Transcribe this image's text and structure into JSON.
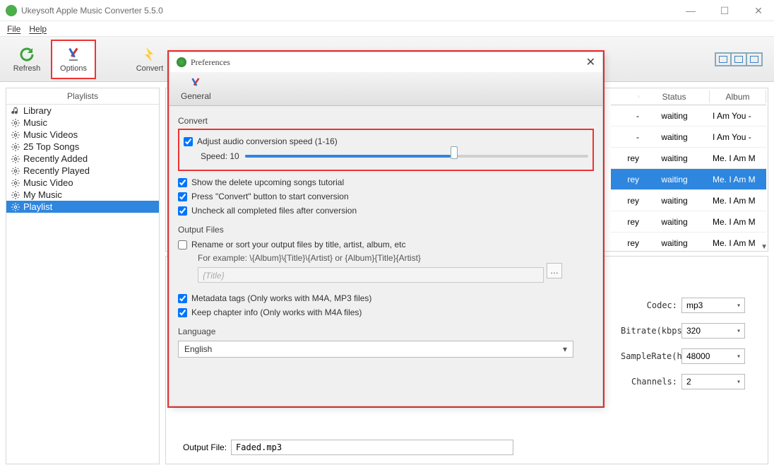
{
  "titlebar": {
    "title": "Ukeysoft Apple Music Converter 5.5.0"
  },
  "menu": {
    "file": "File",
    "help": "Help"
  },
  "toolbar": {
    "refresh": "Refresh",
    "options": "Options",
    "convert": "Convert"
  },
  "sidebar": {
    "header": "Playlists",
    "items": [
      {
        "label": "Library",
        "icon": "library"
      },
      {
        "label": "Music",
        "icon": "gear"
      },
      {
        "label": "Music Videos",
        "icon": "gear"
      },
      {
        "label": "25 Top Songs",
        "icon": "gear"
      },
      {
        "label": "Recently Added",
        "icon": "gear"
      },
      {
        "label": "Recently Played",
        "icon": "gear"
      },
      {
        "label": "Music Video",
        "icon": "gear"
      },
      {
        "label": "My Music",
        "icon": "gear"
      },
      {
        "label": "Playlist",
        "icon": "gear",
        "selected": true
      }
    ]
  },
  "table": {
    "headers": {
      "status": "Status",
      "album": "Album"
    },
    "rows": [
      {
        "c1": "-",
        "status": "waiting",
        "album": "I Am You -"
      },
      {
        "c1": "-",
        "status": "waiting",
        "album": "I Am You -"
      },
      {
        "c1": "rey",
        "status": "waiting",
        "album": "Me. I Am M"
      },
      {
        "c1": "rey",
        "status": "waiting",
        "album": "Me. I Am M",
        "sel": true
      },
      {
        "c1": "rey",
        "status": "waiting",
        "album": "Me. I Am M"
      },
      {
        "c1": "rey",
        "status": "waiting",
        "album": "Me. I Am M"
      },
      {
        "c1": "rey",
        "status": "waiting",
        "album": "Me. I Am M"
      }
    ]
  },
  "settings": {
    "codec_label": "Codec:",
    "codec": "mp3",
    "bitrate_label": "Bitrate(kbps):",
    "bitrate": "320",
    "samplerate_label": "SampleRate(hz):",
    "samplerate": "48000",
    "channels_label": "Channels:",
    "channels": "2"
  },
  "output": {
    "label": "Output File:",
    "value": "Faded.mp3"
  },
  "pref": {
    "title": "Preferences",
    "general_tab": "General",
    "convert_section": "Convert",
    "adjust_speed": "Adjust audio conversion speed (1-16)",
    "speed_label": "Speed: 10",
    "show_tutorial": "Show the delete upcoming songs tutorial",
    "press_convert": "Press \"Convert\" button to start conversion",
    "uncheck_completed": "Uncheck all completed files after conversion",
    "outputfiles_section": "Output Files",
    "rename_option": "Rename or sort your output files by title, artist, album, etc",
    "rename_example": "For example: \\{Album}\\{Title}\\{Artist} or {Album}{Title}{Artist}",
    "rename_placeholder": "{Title}",
    "metadata": "Metadata tags (Only works with M4A, MP3 files)",
    "chapter": "Keep chapter info (Only works with M4A files)",
    "language_section": "Language",
    "language": "English"
  }
}
